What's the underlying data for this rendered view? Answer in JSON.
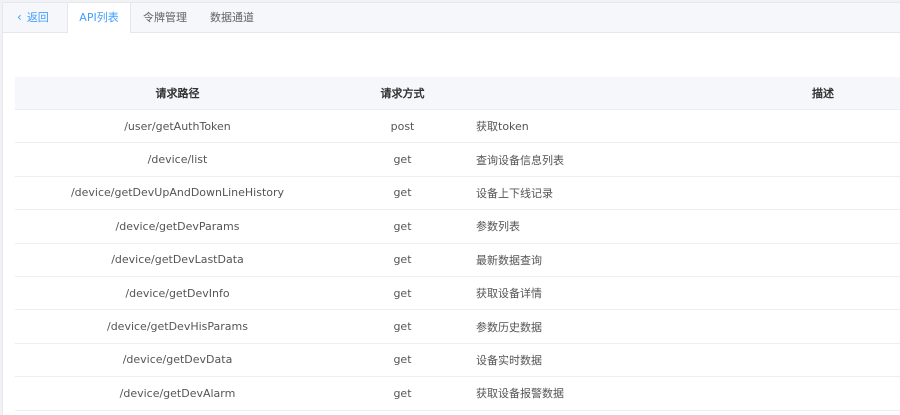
{
  "tabs": {
    "back_label": "返回",
    "items": [
      "API列表",
      "令牌管理",
      "数据通道"
    ],
    "active_index": 0
  },
  "table": {
    "headers": [
      "请求路径",
      "请求方式",
      "描述"
    ],
    "rows": [
      {
        "path": "/user/getAuthToken",
        "method": "post",
        "desc": "获取token"
      },
      {
        "path": "/device/list",
        "method": "get",
        "desc": "查询设备信息列表"
      },
      {
        "path": "/device/getDevUpAndDownLineHistory",
        "method": "get",
        "desc": "设备上下线记录"
      },
      {
        "path": "/device/getDevParams",
        "method": "get",
        "desc": "参数列表"
      },
      {
        "path": "/device/getDevLastData",
        "method": "get",
        "desc": "最新数据查询"
      },
      {
        "path": "/device/getDevInfo",
        "method": "get",
        "desc": "获取设备详情"
      },
      {
        "path": "/device/getDevHisParams",
        "method": "get",
        "desc": "参数历史数据"
      },
      {
        "path": "/device/getDevData",
        "method": "get",
        "desc": "设备实时数据"
      },
      {
        "path": "/device/getDevAlarm",
        "method": "get",
        "desc": "获取设备报警数据"
      }
    ]
  },
  "colors": {
    "accent": "#409eff",
    "header_bg": "#f5f7fa",
    "border": "#ebeef5"
  }
}
